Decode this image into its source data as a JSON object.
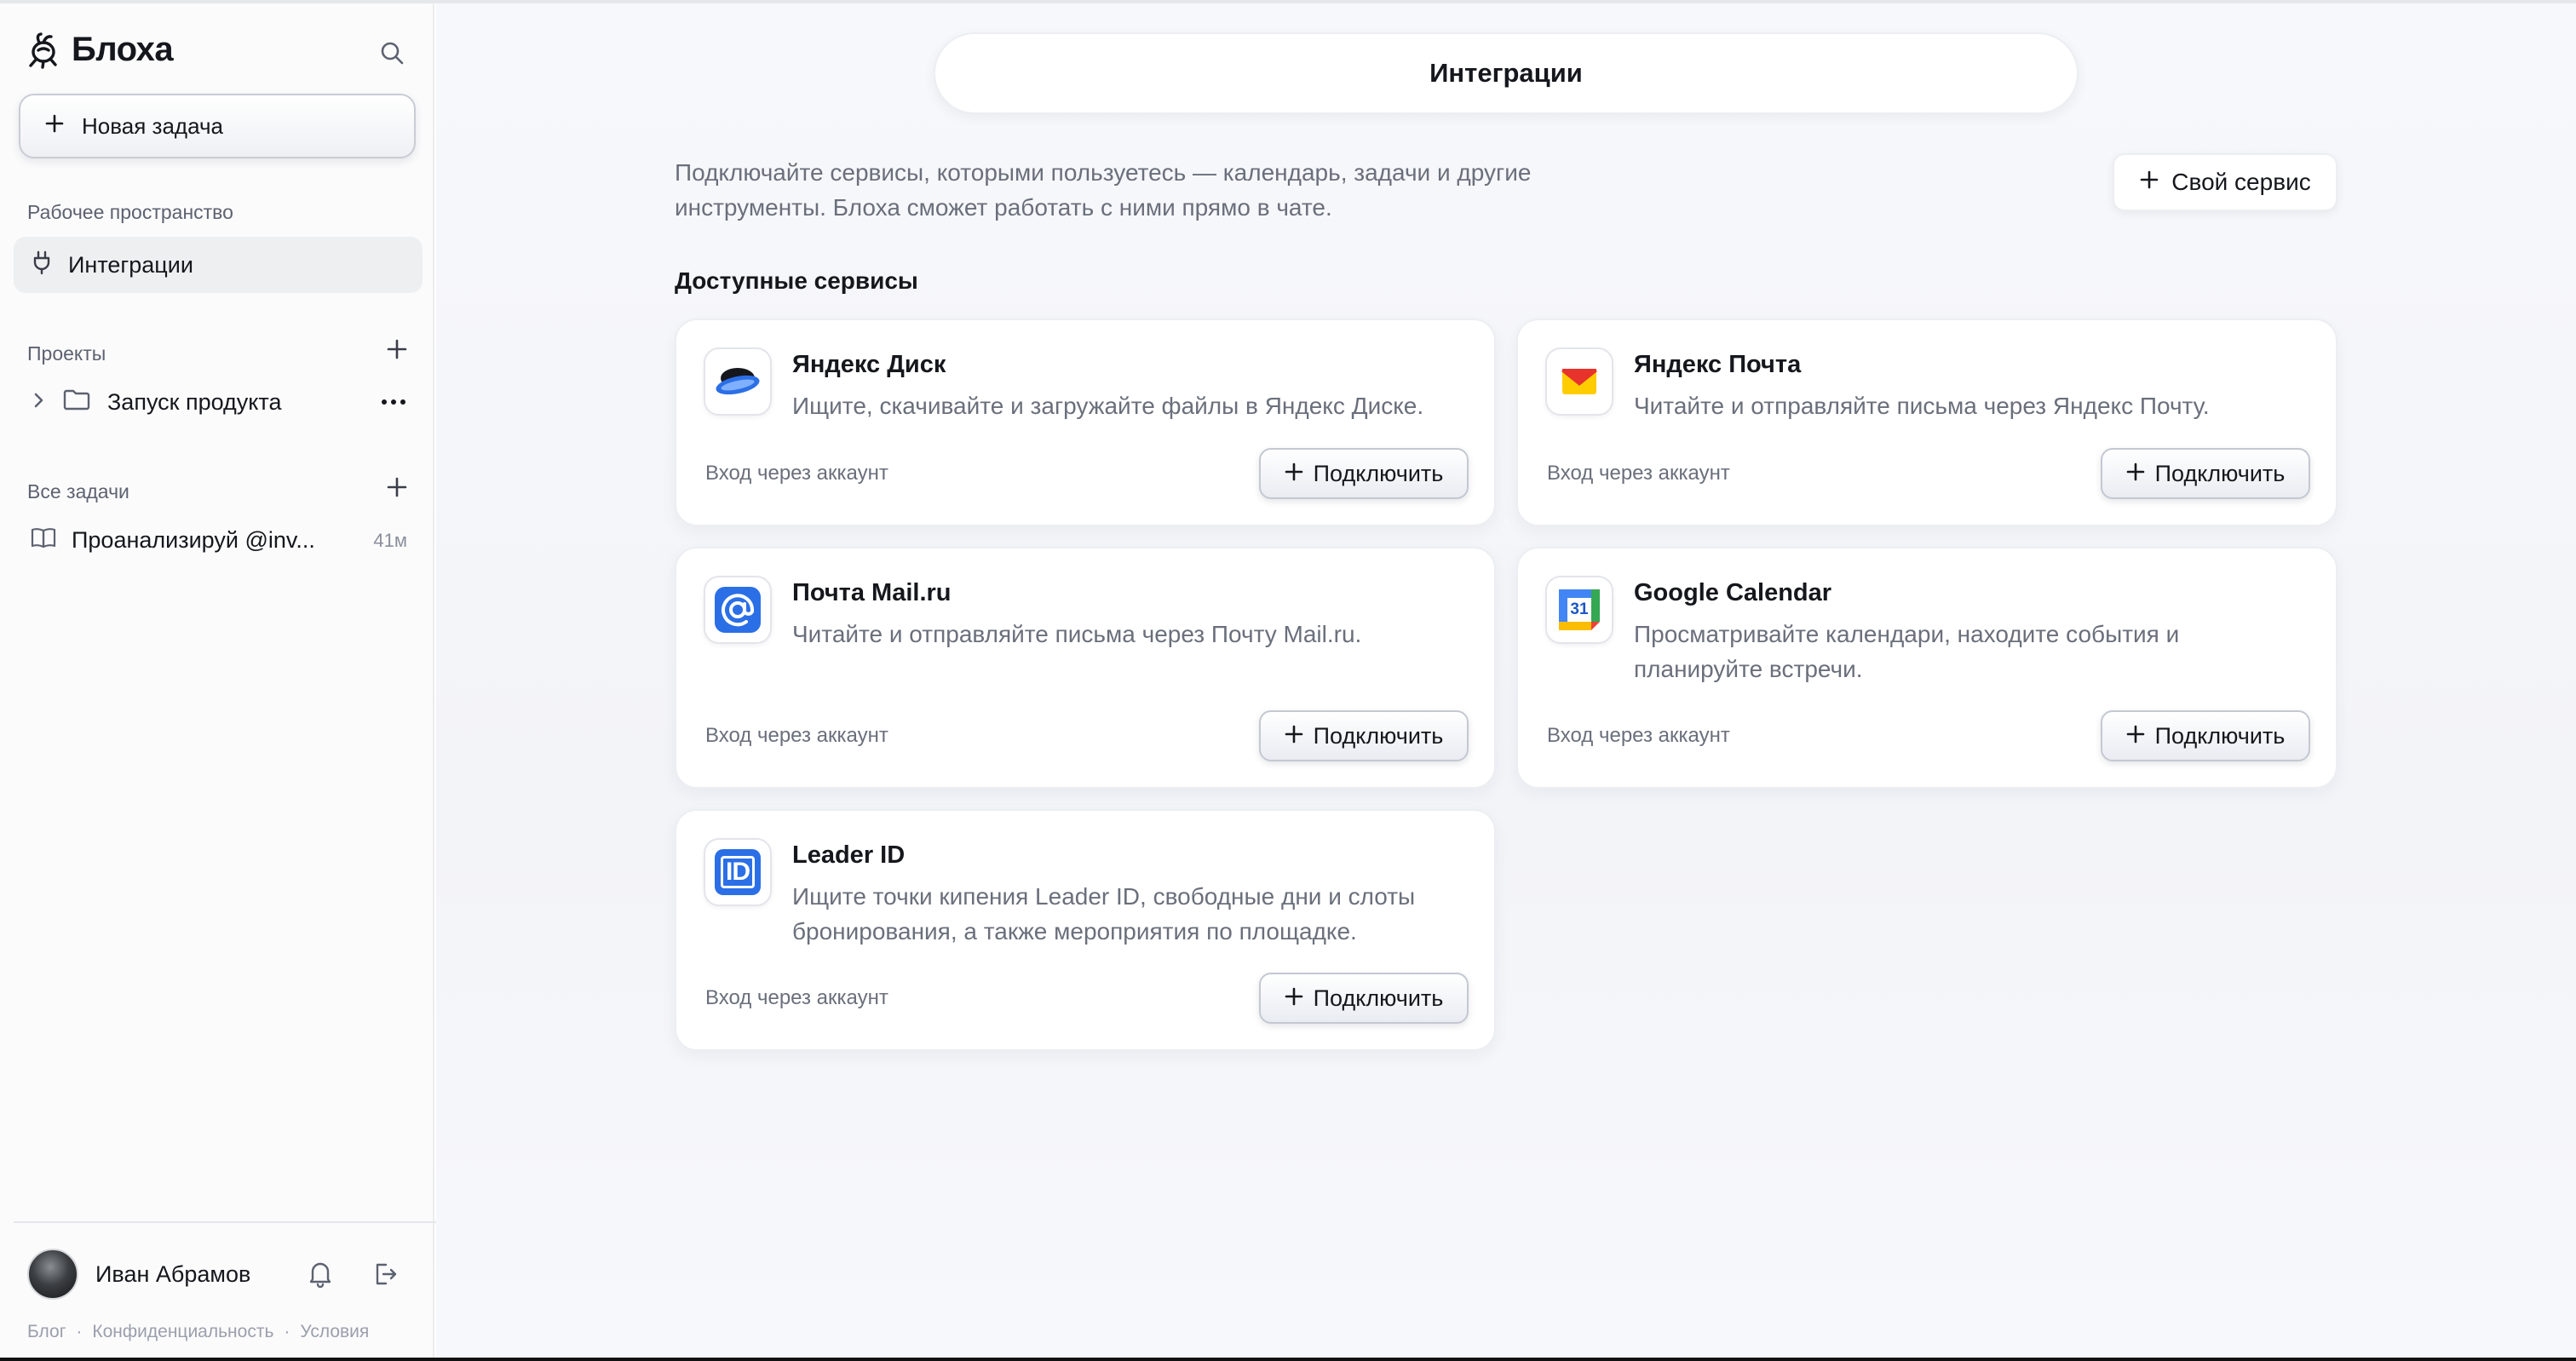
{
  "sidebar": {
    "brand": "Блоха",
    "new_task": "Новая задача",
    "workspace_label": "Рабочее пространство",
    "nav_integrations": "Интеграции",
    "projects_label": "Проекты",
    "project_name": "Запуск продукта",
    "all_tasks_label": "Все задачи",
    "task_title": "Проанализируй @inv...",
    "task_time": "41м",
    "user_name": "Иван Абрамов",
    "footer": [
      "Блог",
      "·",
      "Конфиденциальность",
      "·",
      "Условия"
    ]
  },
  "main": {
    "title": "Интеграции",
    "intro_line1": "Подключайте сервисы, которыми пользуетесь — календарь, задачи и другие",
    "intro_line2": "инструменты. Блоха сможет работать с ними прямо в чате.",
    "own_service": "Свой сервис",
    "section_title": "Доступные сервисы",
    "cards": [
      {
        "title": "Яндекс Диск",
        "desc": "Ищите, скачивайте и загружайте файлы в Яндекс Диске.",
        "auth": "Вход через аккаунт",
        "button": "Подключить",
        "icon": "yandex-disk-icon"
      },
      {
        "title": "Яндекс Почта",
        "desc": "Читайте и отправляйте письма через Яндекс Почту.",
        "auth": "Вход через аккаунт",
        "button": "Подключить",
        "icon": "yandex-mail-icon"
      },
      {
        "title": "Почта Mail.ru",
        "desc": "Читайте и отправляйте письма через Почту Mail.ru.",
        "auth": "Вход через аккаунт",
        "button": "Подключить",
        "icon": "mailru-icon"
      },
      {
        "title": "Google Calendar",
        "desc": "Просматривайте календари, находите события и планируйте встречи.",
        "auth": "Вход через аккаунт",
        "button": "Подключить",
        "icon": "google-calendar-icon",
        "icon_text": "31"
      },
      {
        "title": "Leader ID",
        "desc": "Ищите точки кипения Leader ID, свободные дни и слоты бронирования, а также мероприятия по площадке.",
        "auth": "Вход через аккаунт",
        "button": "Подключить",
        "icon": "leader-id-icon",
        "icon_text": "ID"
      }
    ]
  },
  "colors": {
    "accent_blue": "#2b6fe6",
    "yandex_red": "#e8322c",
    "yandex_yellow": "#ffcc00"
  }
}
